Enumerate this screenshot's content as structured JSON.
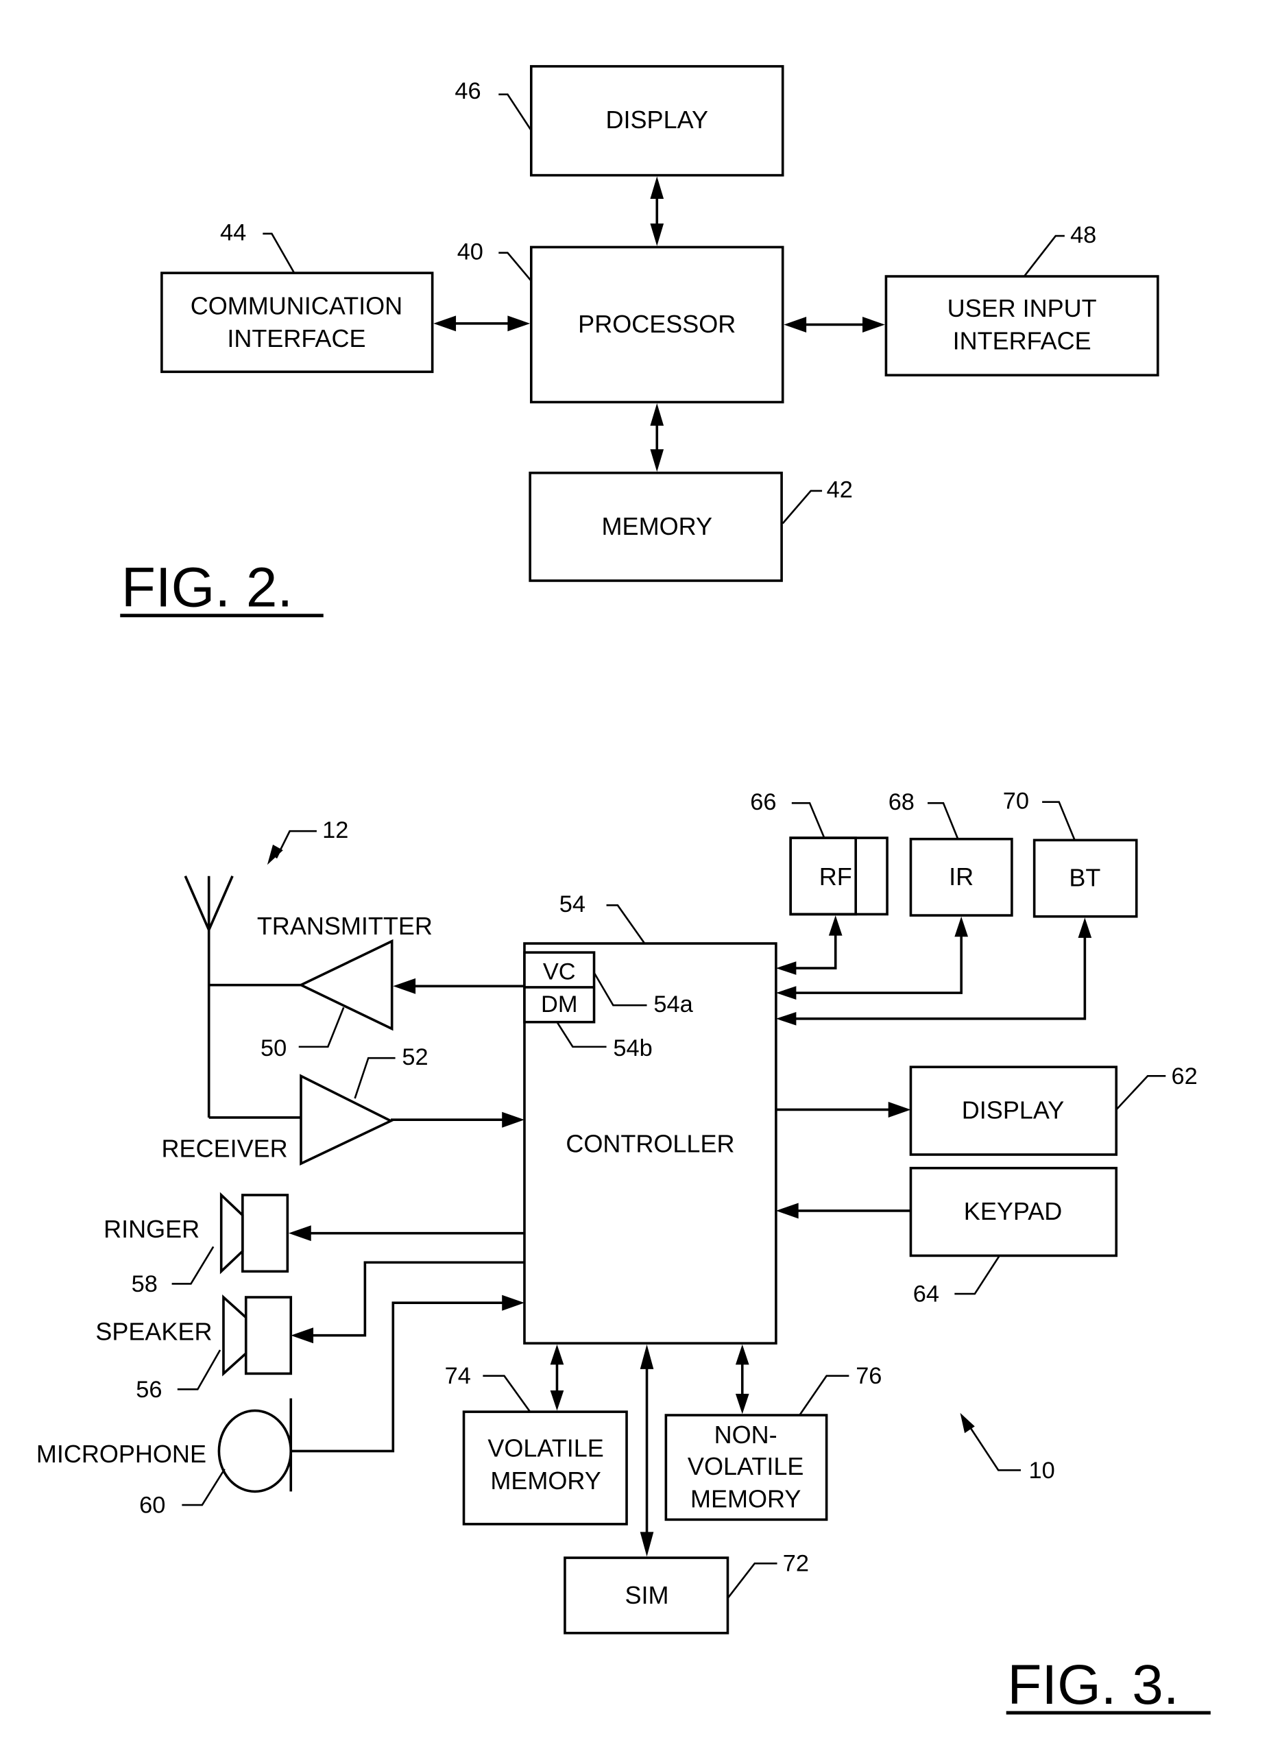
{
  "fig2": {
    "caption": "FIG. 2.",
    "blocks": {
      "display": {
        "label": "DISPLAY",
        "ref": "46"
      },
      "processor": {
        "label": "PROCESSOR",
        "ref": "40"
      },
      "communication": {
        "line1": "COMMUNICATION",
        "line2": "INTERFACE",
        "ref": "44"
      },
      "user_input": {
        "line1": "USER INPUT",
        "line2": "INTERFACE",
        "ref": "48"
      },
      "memory": {
        "label": "MEMORY",
        "ref": "42"
      }
    }
  },
  "fig3": {
    "caption": "FIG. 3.",
    "device_ref": "10",
    "antenna_ref": "12",
    "transmitter": {
      "label": "TRANSMITTER",
      "ref": "50"
    },
    "receiver": {
      "label": "RECEIVER",
      "ref": "52"
    },
    "controller": {
      "label": "CONTROLLER",
      "ref": "54",
      "vc": {
        "label": "VC",
        "ref": "54a"
      },
      "dm": {
        "label": "DM",
        "ref": "54b"
      }
    },
    "rf": {
      "label": "RF",
      "ref": "66"
    },
    "ir": {
      "label": "IR",
      "ref": "68"
    },
    "bt": {
      "label": "BT",
      "ref": "70"
    },
    "display": {
      "label": "DISPLAY",
      "ref": "62"
    },
    "keypad": {
      "label": "KEYPAD",
      "ref": "64"
    },
    "ringer": {
      "label": "RINGER",
      "ref": "58"
    },
    "speaker": {
      "label": "SPEAKER",
      "ref": "56"
    },
    "microphone": {
      "label": "MICROPHONE",
      "ref": "60"
    },
    "volatile_memory": {
      "line1": "VOLATILE",
      "line2": "MEMORY",
      "ref": "74"
    },
    "non_volatile_memory": {
      "line1": "NON-",
      "line2": "VOLATILE",
      "line3": "MEMORY",
      "ref": "76"
    },
    "sim": {
      "label": "SIM",
      "ref": "72"
    }
  }
}
